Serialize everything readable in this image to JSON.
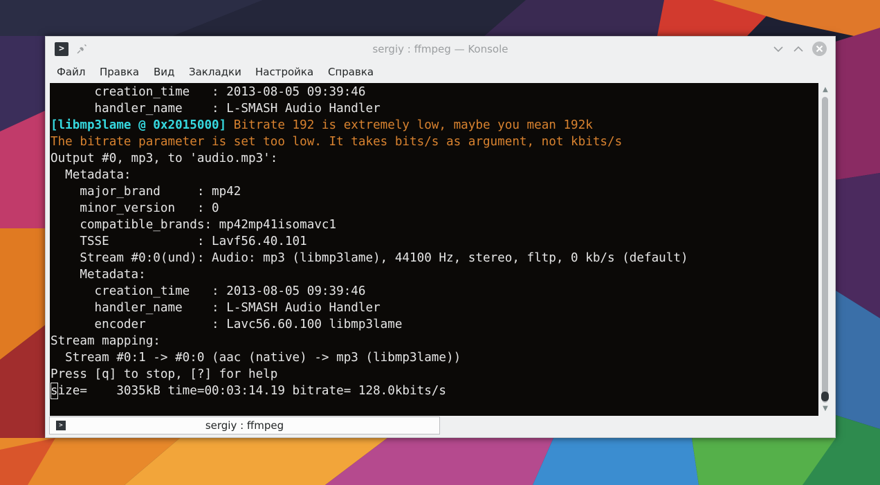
{
  "window": {
    "title": "sergiy : ffmpeg — Konsole"
  },
  "menu": [
    "Файл",
    "Правка",
    "Вид",
    "Закладки",
    "Настройка",
    "Справка"
  ],
  "terminal": {
    "lines": [
      [
        {
          "t": "      creation_time   : 2013-08-05 09:39:46",
          "c": ""
        }
      ],
      [
        {
          "t": "      handler_name    : L-SMASH Audio Handler",
          "c": ""
        }
      ],
      [
        {
          "t": "[libmp3lame @ 0x2015000]",
          "c": "cyan"
        },
        {
          "t": " Bitrate 192 is extremely low, maybe you mean 192k",
          "c": "orange"
        }
      ],
      [
        {
          "t": "The bitrate parameter is set too low. It takes bits/s as argument, not kbits/s",
          "c": "orange"
        }
      ],
      [
        {
          "t": "Output #0, mp3, to 'audio.mp3':",
          "c": ""
        }
      ],
      [
        {
          "t": "  Metadata:",
          "c": ""
        }
      ],
      [
        {
          "t": "    major_brand     : mp42",
          "c": ""
        }
      ],
      [
        {
          "t": "    minor_version   : 0",
          "c": ""
        }
      ],
      [
        {
          "t": "    compatible_brands: mp42mp41isomavc1",
          "c": ""
        }
      ],
      [
        {
          "t": "    TSSE            : Lavf56.40.101",
          "c": ""
        }
      ],
      [
        {
          "t": "    Stream #0:0(und): Audio: mp3 (libmp3lame), 44100 Hz, stereo, fltp, 0 kb/s (default)",
          "c": ""
        }
      ],
      [
        {
          "t": "    Metadata:",
          "c": ""
        }
      ],
      [
        {
          "t": "      creation_time   : 2013-08-05 09:39:46",
          "c": ""
        }
      ],
      [
        {
          "t": "      handler_name    : L-SMASH Audio Handler",
          "c": ""
        }
      ],
      [
        {
          "t": "      encoder         : Lavc56.60.100 libmp3lame",
          "c": ""
        }
      ],
      [
        {
          "t": "Stream mapping:",
          "c": ""
        }
      ],
      [
        {
          "t": "  Stream #0:1 -> #0:0 (aac (native) -> mp3 (libmp3lame))",
          "c": ""
        }
      ],
      [
        {
          "t": "Press [q] to stop, [?] for help",
          "c": ""
        }
      ],
      [
        {
          "t": "s",
          "c": "cursor"
        },
        {
          "t": "ize=    3035kB time=00:03:14.19 bitrate= 128.0kbits/s",
          "c": ""
        }
      ]
    ]
  },
  "tab": {
    "label": "sergiy : ffmpeg"
  },
  "icons": {
    "app": "konsole-icon",
    "pin": "pin-icon",
    "minimize": "chevron-down-icon",
    "maximize": "chevron-up-icon",
    "close": "close-icon"
  },
  "colors": {
    "terminal_bg": "#0b0907",
    "terminal_fg": "#e6e6e6",
    "ansi_cyan": "#36d8df",
    "ansi_orange": "#d8822f",
    "window_bg": "#eff0f1"
  }
}
